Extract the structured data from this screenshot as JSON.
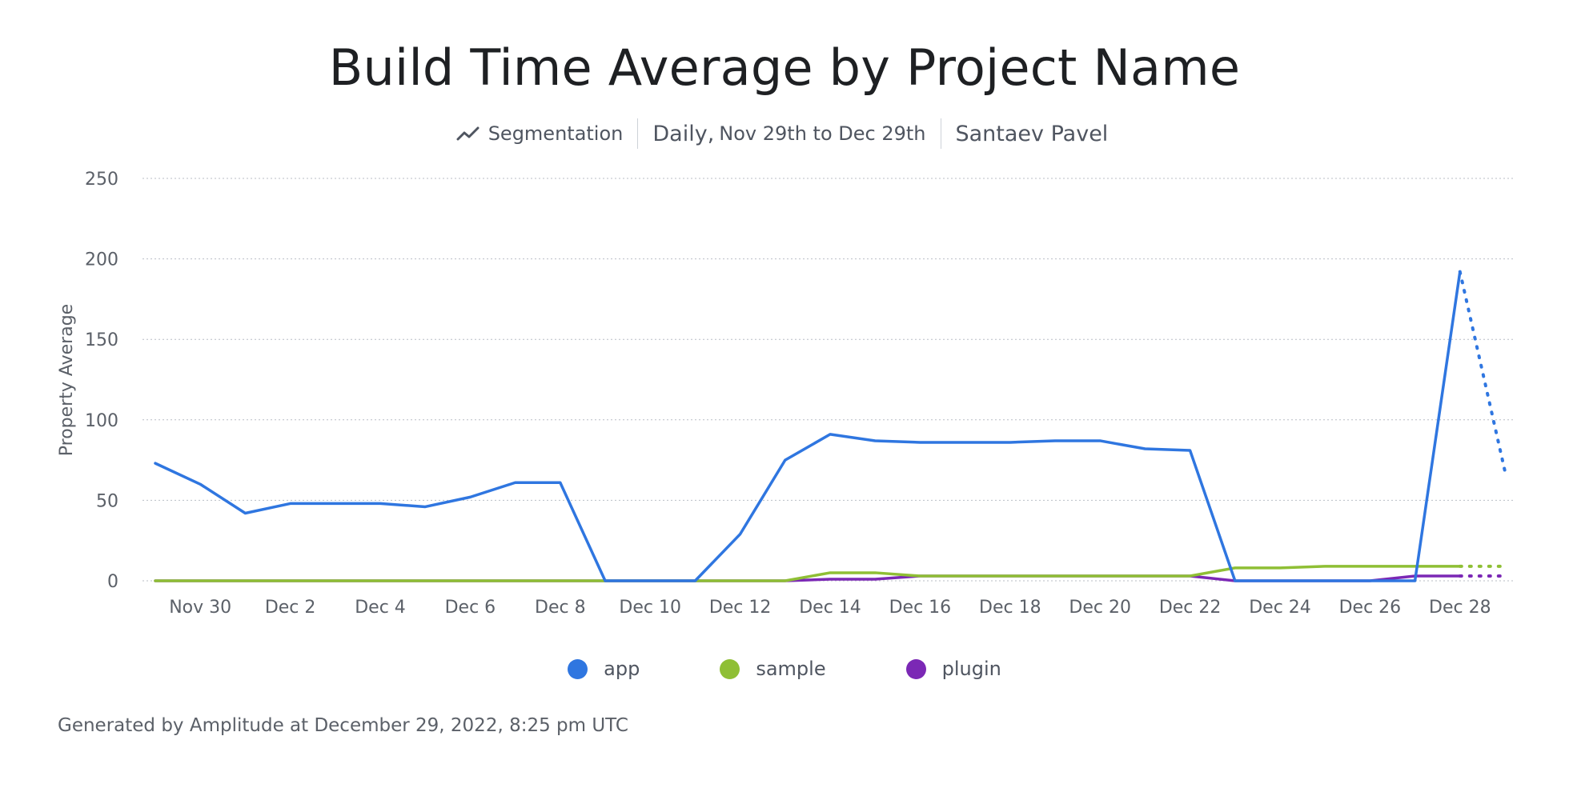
{
  "header": {
    "title": "Build Time Average by Project Name",
    "segment_icon": "line-chart-icon",
    "segment_label": "Segmentation",
    "interval_label": "Daily,",
    "range_label": "Nov 29th to Dec 29th",
    "owner": "Santaev Pavel"
  },
  "chart_data": {
    "type": "line",
    "title": "Build Time Average by Project Name",
    "xlabel": "",
    "ylabel": "Property Average",
    "ylim": [
      0,
      250
    ],
    "yticks": [
      0,
      50,
      100,
      150,
      200,
      250
    ],
    "grid": true,
    "legend_position": "bottom",
    "x": [
      "Nov 29",
      "Nov 30",
      "Dec 1",
      "Dec 2",
      "Dec 3",
      "Dec 4",
      "Dec 5",
      "Dec 6",
      "Dec 7",
      "Dec 8",
      "Dec 9",
      "Dec 10",
      "Dec 11",
      "Dec 12",
      "Dec 13",
      "Dec 14",
      "Dec 15",
      "Dec 16",
      "Dec 17",
      "Dec 18",
      "Dec 19",
      "Dec 20",
      "Dec 21",
      "Dec 22",
      "Dec 23",
      "Dec 24",
      "Dec 25",
      "Dec 26",
      "Dec 27",
      "Dec 28",
      "Dec 29"
    ],
    "xtick_labels": [
      "Nov 30",
      "Dec 2",
      "Dec 4",
      "Dec 6",
      "Dec 8",
      "Dec 10",
      "Dec 12",
      "Dec 14",
      "Dec 16",
      "Dec 18",
      "Dec 20",
      "Dec 22",
      "Dec 24",
      "Dec 26",
      "Dec 28"
    ],
    "incomplete_from": "Dec 28",
    "series": [
      {
        "name": "app",
        "color": "#2f76e0",
        "values": [
          73,
          60,
          42,
          48,
          48,
          48,
          46,
          52,
          61,
          61,
          0,
          0,
          0,
          29,
          75,
          91,
          87,
          86,
          86,
          86,
          87,
          87,
          82,
          81,
          0,
          0,
          0,
          0,
          0,
          192,
          68
        ]
      },
      {
        "name": "sample",
        "color": "#8fbf35",
        "values": [
          0,
          0,
          0,
          0,
          0,
          0,
          0,
          0,
          0,
          0,
          0,
          0,
          0,
          0,
          0,
          5,
          5,
          3,
          3,
          3,
          3,
          3,
          3,
          3,
          8,
          8,
          9,
          9,
          9,
          9,
          9
        ]
      },
      {
        "name": "plugin",
        "color": "#7b28b5",
        "values": [
          0,
          0,
          0,
          0,
          0,
          0,
          0,
          0,
          0,
          0,
          0,
          0,
          0,
          0,
          0,
          1,
          1,
          3,
          3,
          3,
          3,
          3,
          3,
          3,
          0,
          0,
          0,
          0,
          3,
          3,
          3
        ]
      }
    ]
  },
  "footer": {
    "text": "Generated by Amplitude at December 29, 2022, 8:25 pm UTC"
  }
}
